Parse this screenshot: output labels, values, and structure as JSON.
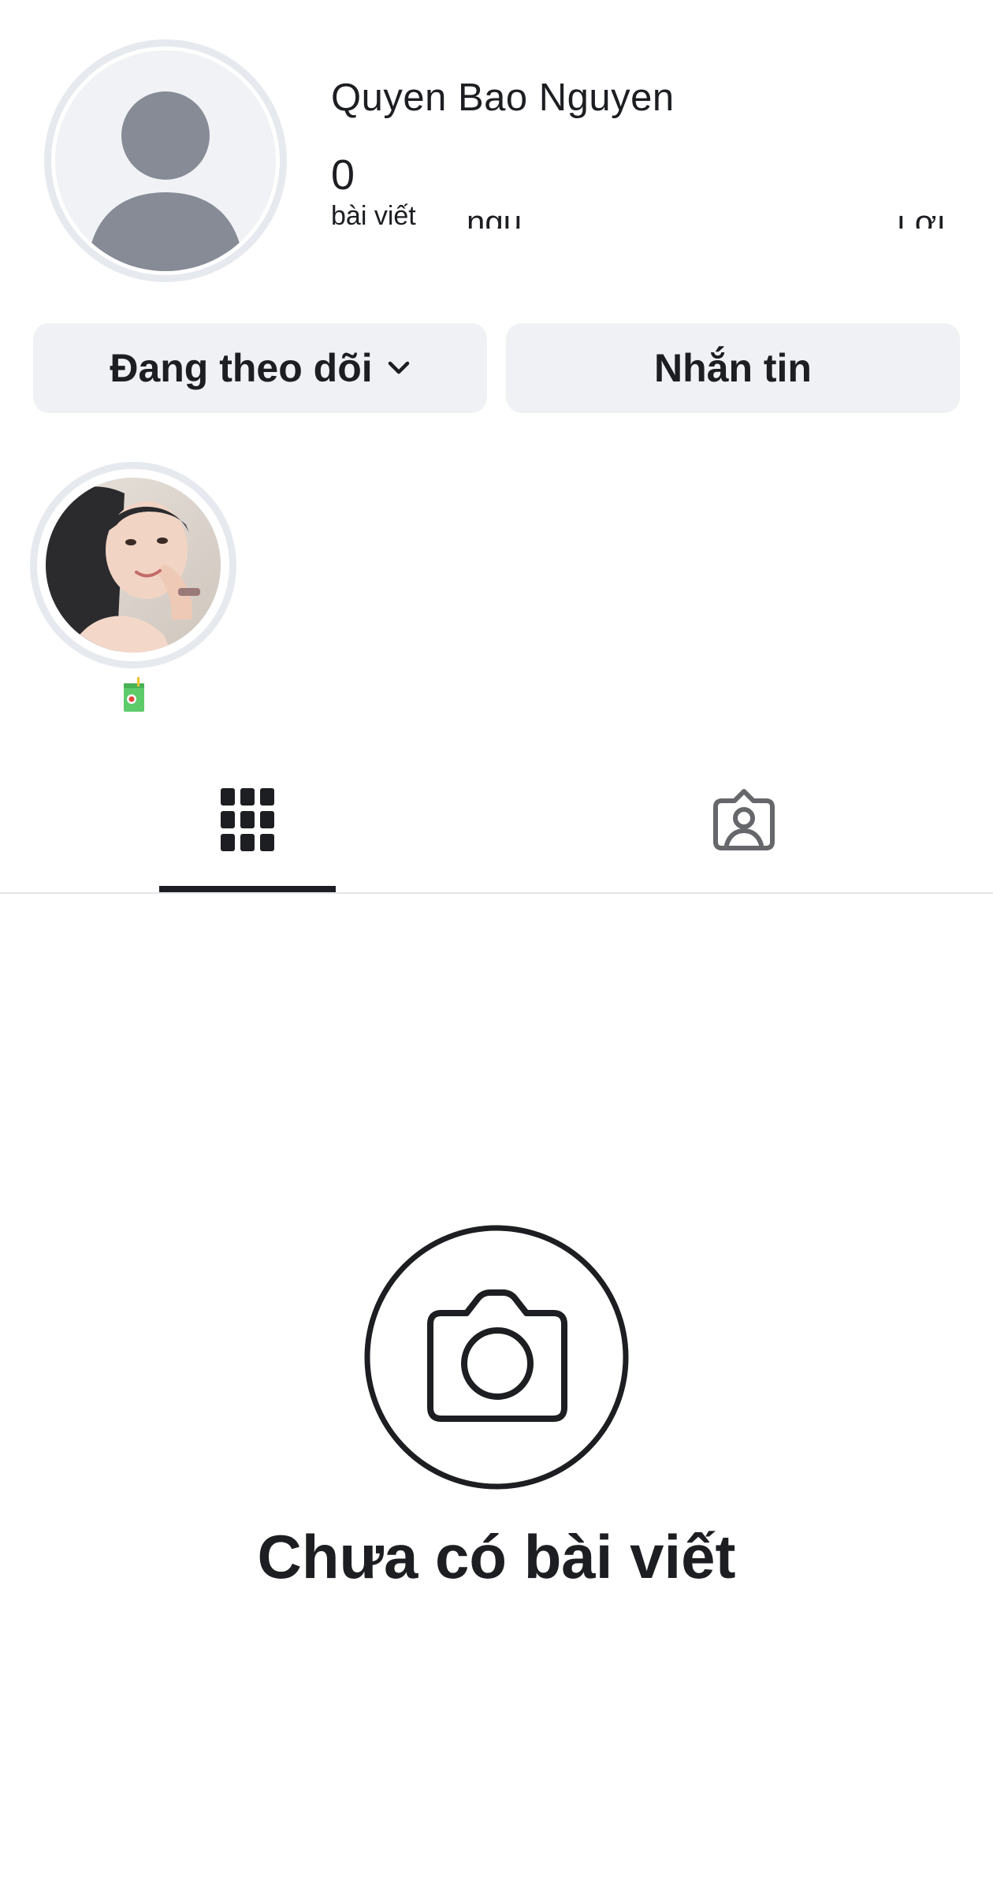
{
  "profile": {
    "username": "Quyen Bao Nguyen",
    "stats": {
      "posts_count": "0",
      "posts_label": "bài viết",
      "followers_label_partial": "ngu",
      "following_label_partial": "ı.ơı"
    }
  },
  "actions": {
    "follow_label": "Đang theo dõi",
    "message_label": "Nhắn tin"
  },
  "highlight": {
    "icon": "juice-box-emoji"
  },
  "tabs": [
    {
      "name": "posts-grid",
      "icon": "grid-icon",
      "active": true
    },
    {
      "name": "tagged",
      "icon": "tagged-person-icon",
      "active": false
    }
  ],
  "empty_state": {
    "icon": "camera-icon",
    "title": "Chưa có bài viết"
  },
  "colors": {
    "text": "#1c1e21",
    "button_bg": "#eff1f4",
    "avatar_placeholder": "#8a8d91",
    "ring": "#e6e9ee"
  }
}
